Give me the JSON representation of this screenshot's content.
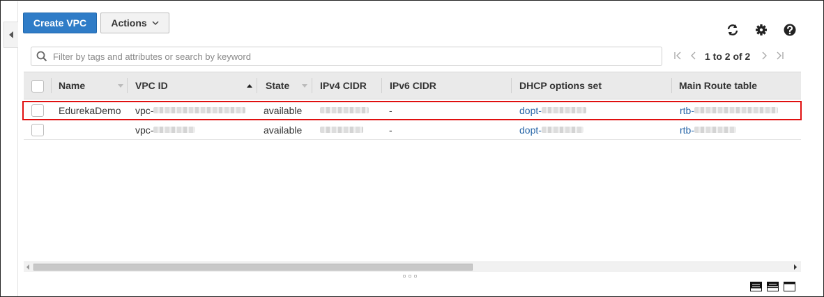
{
  "toolbar": {
    "create_label": "Create VPC",
    "actions_label": "Actions"
  },
  "icons": {
    "refresh": "refresh-icon",
    "settings": "gear-icon",
    "help": "help-icon",
    "search": "search-icon"
  },
  "search": {
    "value": "",
    "placeholder": "Filter by tags and attributes or search by keyword"
  },
  "pagination": {
    "text": "1 to 2 of 2"
  },
  "table": {
    "columns": [
      "Name",
      "VPC ID",
      "State",
      "IPv4 CIDR",
      "IPv6 CIDR",
      "DHCP options set",
      "Main Route table"
    ],
    "sorted_column": "VPC ID",
    "sort_direction": "ascending",
    "rows": [
      {
        "name": "EdurekaDemo",
        "vpc_id": "vpc-",
        "state": "available",
        "ipv6": "-",
        "dhcp": "dopt-",
        "route": "rtb-",
        "selected_highlight": true
      },
      {
        "name": "",
        "vpc_id": "vpc-",
        "state": "available",
        "ipv6": "-",
        "dhcp": "dopt-",
        "route": "rtb-",
        "selected_highlight": false
      }
    ]
  },
  "colors": {
    "primary_button": "#2f7cc7",
    "link": "#2866a8",
    "highlight_border": "#e01010",
    "header_bg": "#eaeaea"
  }
}
